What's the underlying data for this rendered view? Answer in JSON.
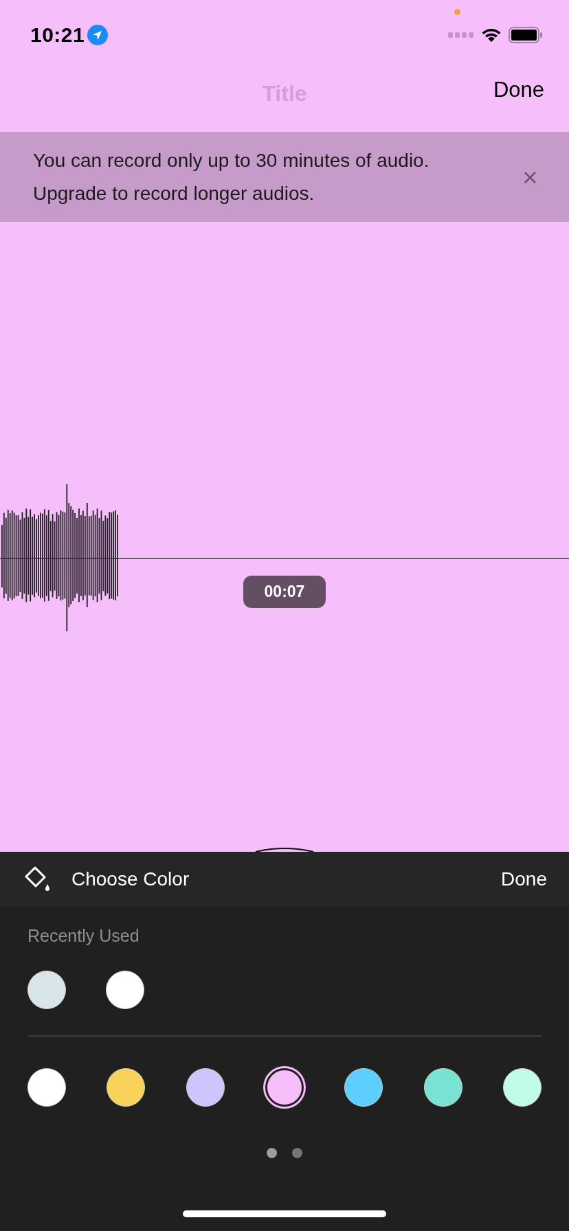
{
  "status_bar": {
    "time": "10:21"
  },
  "nav": {
    "title": "Title",
    "done": "Done"
  },
  "banner": {
    "message": "You can record only up to 30 minutes of audio. Upgrade to record longer audios.",
    "close": "×"
  },
  "recorder": {
    "elapsed": "00:07"
  },
  "color_panel": {
    "title": "Choose Color",
    "done": "Done",
    "recent_label": "Recently Used",
    "recent": [
      {
        "color": "#d8e6ec",
        "selected": false
      },
      {
        "color": "#ffffff",
        "selected": false
      }
    ],
    "palette": [
      {
        "color": "#ffffff",
        "selected": false
      },
      {
        "color": "#f9d25a",
        "selected": false
      },
      {
        "color": "#cdc5fb",
        "selected": false
      },
      {
        "color": "#f6bffc",
        "selected": true
      },
      {
        "color": "#5ccffc",
        "selected": false
      },
      {
        "color": "#79e3d3",
        "selected": false
      },
      {
        "color": "#c2fbe7",
        "selected": false
      }
    ],
    "pages": [
      {
        "selected": true
      },
      {
        "selected": false
      }
    ]
  }
}
